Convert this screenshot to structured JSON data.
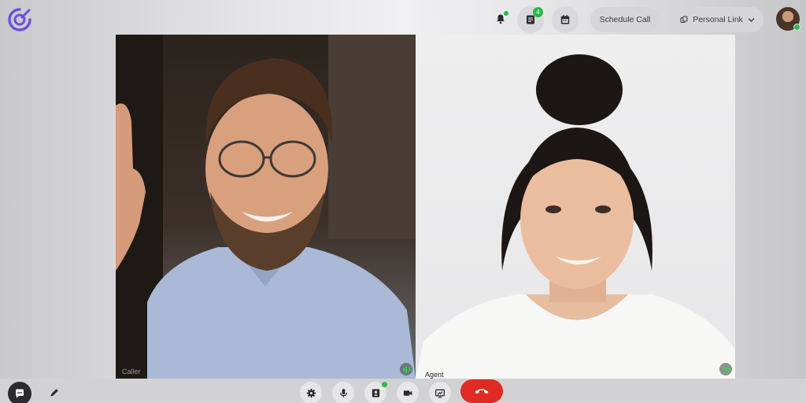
{
  "header": {
    "logo_icon": "app-logo-icon",
    "notifications": {
      "icon": "bell-icon",
      "has_dot": true
    },
    "messages": {
      "icon": "chat-list-icon",
      "badge": "4"
    },
    "calendar": {
      "icon": "calendar-icon"
    },
    "schedule_call_label": "Schedule Call",
    "personal_link_label": "Personal Link",
    "personal_link_icon": "link-icon",
    "user_avatar": {
      "status": "online"
    }
  },
  "participants": [
    {
      "role": "caller",
      "label": "Caller",
      "speaking_icon": "audio-level-icon"
    },
    {
      "role": "agent",
      "label": "Agent",
      "speaking_icon": "audio-level-icon"
    }
  ],
  "controls": {
    "chat_icon": "chat-bubble-icon",
    "notes_icon": "pencil-icon",
    "settings_icon": "gear-icon",
    "mic_icon": "microphone-icon",
    "contact_icon": "contact-card-icon",
    "camera_icon": "video-camera-icon",
    "screen_share_icon": "screen-share-icon",
    "end_call_icon": "phone-hangup-icon"
  },
  "colors": {
    "accent": "#6b4fe0",
    "online": "#2db84c",
    "end_call": "#e02b24"
  }
}
